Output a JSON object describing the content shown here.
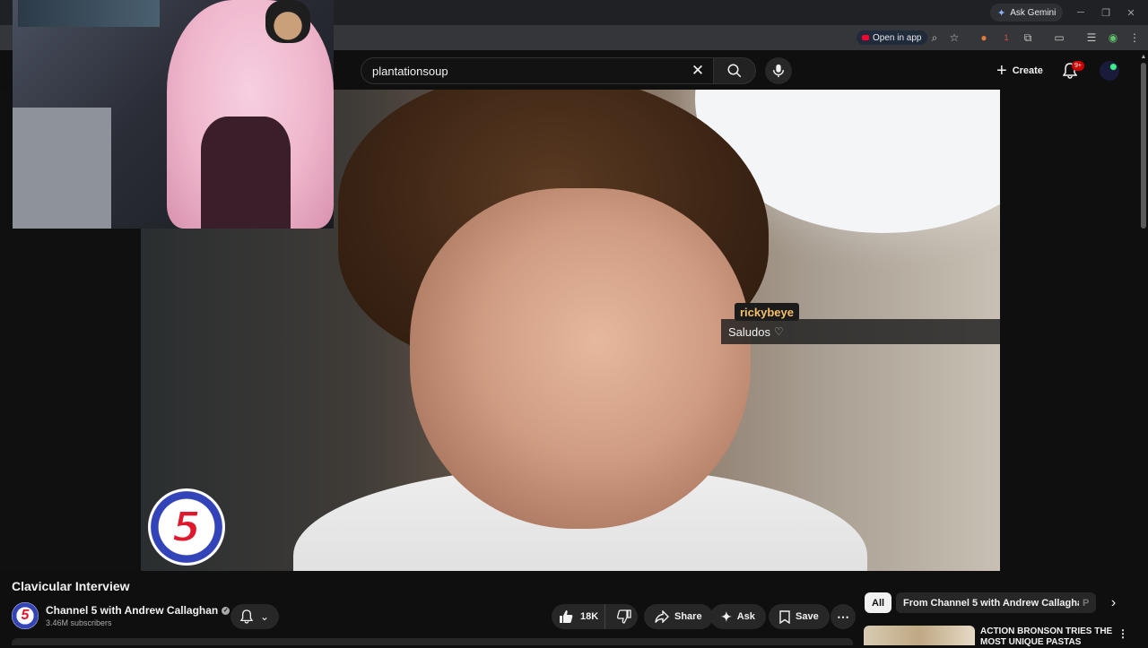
{
  "browser": {
    "ask_gemini_label": "Ask Gemini",
    "open_in_app_label": "Open in app",
    "extension_badge": "1"
  },
  "header": {
    "search_value": "plantationsoup",
    "create_label": "Create",
    "notification_badge": "9+"
  },
  "chat_overlay": {
    "username": "rickybeye",
    "message": "Saludos"
  },
  "video": {
    "logo_text": "5",
    "title": "Clavicular Interview",
    "channel_name": "Channel 5 with Andrew Callaghan",
    "subscribers": "3.46M subscribers",
    "channel_avatar_text": "5"
  },
  "actions": {
    "like_count": "18K",
    "share_label": "Share",
    "ask_label": "Ask",
    "save_label": "Save"
  },
  "related": {
    "chips": [
      "All",
      "From Channel 5 with Andrew Callaghan",
      "P"
    ],
    "first_video_title": "ACTION BRONSON TRIES THE MOST UNIQUE PASTAS"
  },
  "colors": {
    "accent_red": "#ff0033",
    "chat_username": "#f5c06a",
    "background": "#0f0f0f"
  }
}
